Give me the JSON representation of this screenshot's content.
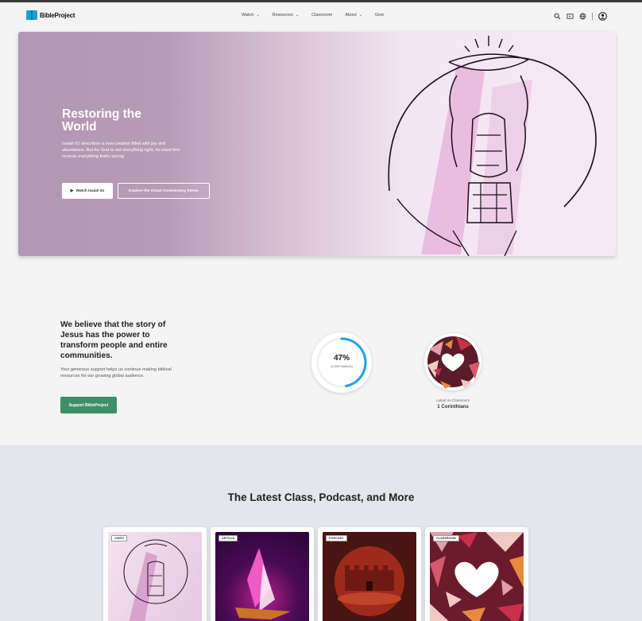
{
  "header": {
    "logo_text": "BibleProject",
    "nav": [
      {
        "label": "Watch",
        "has_dropdown": true
      },
      {
        "label": "Resources",
        "has_dropdown": true
      },
      {
        "label": "Classroom",
        "has_dropdown": false
      },
      {
        "label": "About",
        "has_dropdown": true
      },
      {
        "label": "Give",
        "has_dropdown": false
      }
    ],
    "icons": [
      "search-icon",
      "video-library-icon",
      "globe-icon",
      "profile-icon"
    ]
  },
  "hero": {
    "title": "Restoring the World",
    "description": "Isaiah 61 describes a new creation filled with joy and abundance. But for God to set everything right, he must first reverse everything that's wrong.",
    "watch_button": "Watch Isaiah 61",
    "explore_button": "Explore the Visual Commentary Series",
    "colors": {
      "left": "#b396b1",
      "right": "#f6e9f4"
    }
  },
  "mission": {
    "heading": "We believe that the story of Jesus has the power to transform people and entire communities.",
    "subtext": "Your generous support helps us continue making biblical resources for our growing global audience.",
    "support_button": "Support BibleProject",
    "support_color": "#3e8f68"
  },
  "stat": {
    "percent_label": "47%",
    "progress": 0.47,
    "sub_label": "(3,300 Nations)"
  },
  "classroom_latest": {
    "caption": "Latest on Classroom",
    "title": "1 Corinthians"
  },
  "latest": {
    "title": "The Latest Class, Podcast, and More",
    "cards": [
      {
        "tag": "VIDEO"
      },
      {
        "tag": "ARTICLE"
      },
      {
        "tag": "PODCAST"
      },
      {
        "tag": "CLASSROOM"
      }
    ]
  }
}
